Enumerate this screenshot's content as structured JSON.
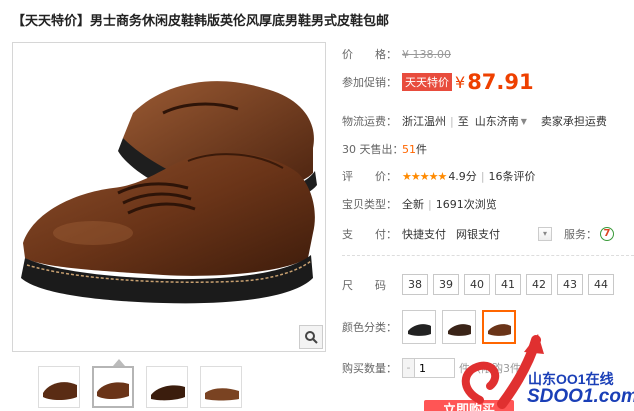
{
  "product": {
    "title": "【天天特价】男士商务休闲皮鞋韩版英伦风厚底男鞋男式皮鞋包邮"
  },
  "price": {
    "label": "价　　格：",
    "original": "¥ 138.00"
  },
  "promotion": {
    "label": "参加促销：",
    "tag": "天天特价",
    "yen": "¥",
    "price": "87.91"
  },
  "shipping": {
    "label": "物流运费：",
    "from": "浙江温州",
    "to_prefix": "至",
    "to": "山东济南",
    "note": "卖家承担运费"
  },
  "sales": {
    "label": "30 天售出：",
    "count": "51",
    "unit": "件"
  },
  "rating": {
    "label": "评　　价：",
    "stars": "★★★★★",
    "score": "4.9分",
    "reviews": "16条评价"
  },
  "item_type": {
    "label": "宝贝类型：",
    "condition": "全新",
    "views": "1691次浏览"
  },
  "payment": {
    "label": "支　　付：",
    "method1": "快捷支付",
    "method2": "网银支付",
    "service_label": "服务：",
    "service_icon_text": "7"
  },
  "size": {
    "label": "尺　　码",
    "options": [
      "38",
      "39",
      "40",
      "41",
      "42",
      "43",
      "44"
    ]
  },
  "color": {
    "label": "颜色分类："
  },
  "quantity": {
    "label": "购买数量：",
    "minus": "-",
    "value": "1",
    "unit_note": "件（限购3件）"
  },
  "buy_button": {
    "label": "立即购买"
  },
  "watermark": {
    "line1": "山东OO1在线",
    "line2": "SDOO1.com"
  },
  "colors": {
    "accent": "#ee4000",
    "promo_tag": "#e84c3d",
    "watermark": "#1a3fb7"
  }
}
